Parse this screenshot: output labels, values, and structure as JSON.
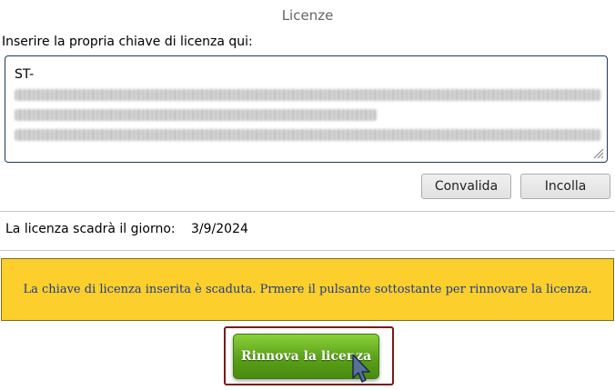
{
  "header": {
    "title": "Licenze"
  },
  "license": {
    "prompt": "Inserire la propria chiave di licenza qui:",
    "key_value": "ST-",
    "validate_label": "Convalida",
    "paste_label": "Incolla",
    "expiry_label": "La licenza scadrà il giorno:",
    "expiry_date": "3/9/2024"
  },
  "warning": {
    "message": "La chiave di licenza inserita è scaduta. Prmere il pulsante sottostante per rinnovare la licenza."
  },
  "renew": {
    "label": "Rinnova la licenza"
  },
  "colors": {
    "warning_bg": "#fccf2c",
    "warning_text": "#1f3a8a",
    "renew_button": "#5aa018",
    "highlight_frame": "#7a1a1a"
  },
  "icons": {
    "textarea_resize": "resize-grip-icon",
    "pointer": "mouse-pointer-icon"
  }
}
